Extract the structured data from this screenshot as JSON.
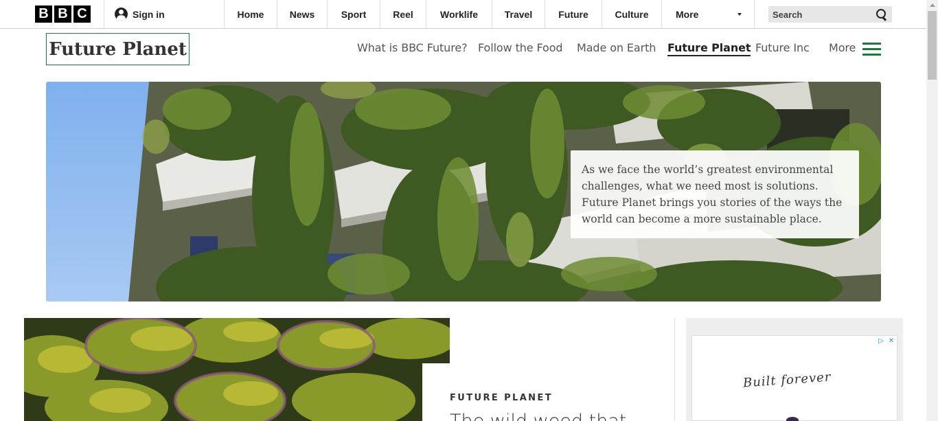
{
  "global_bar": {
    "logo_letters": [
      "B",
      "B",
      "C"
    ],
    "signin_label": "Sign in",
    "nav": [
      "Home",
      "News",
      "Sport",
      "Reel",
      "Worklife",
      "Travel",
      "Future",
      "Culture"
    ],
    "more_label": "More",
    "search_placeholder": "Search"
  },
  "section": {
    "title": "Future Planet",
    "nav": [
      "What is BBC Future?",
      "Follow the Food",
      "Made on Earth",
      "Future Planet",
      "Future Inc"
    ],
    "active_item": "Future Planet",
    "more_label": "More",
    "accent_color": "#1b7a3b"
  },
  "hero": {
    "caption": "As we face the world’s greatest environmental challenges, what we need most is solutions. Future Planet brings you stories of the ways the world can become a more sustainable place."
  },
  "feature": {
    "kicker": "FUTURE PLANET",
    "title": "The wild weed that"
  },
  "ad": {
    "brand_script": "Built forever"
  }
}
